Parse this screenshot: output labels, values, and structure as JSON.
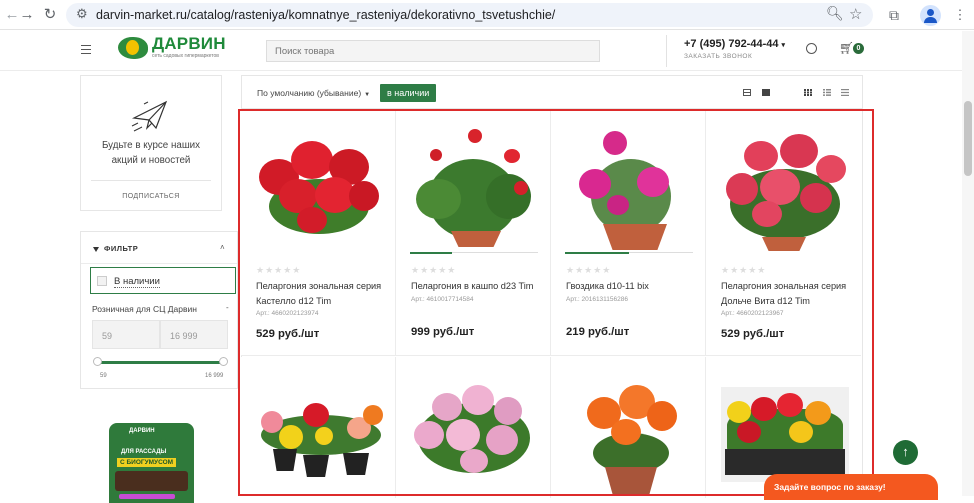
{
  "browser": {
    "url": "darvin-market.ru/catalog/rasteniya/komnatnye_rasteniya/dekorativno_tsvetushchie/"
  },
  "header": {
    "logo_name": "ДАРВИН",
    "logo_sub": "сеть садовых гипермаркетов",
    "search_placeholder": "Поиск товара",
    "phone": "+7 (495) 792-44-44",
    "phone_caret": "▾",
    "callback": "ЗАКАЗАТЬ ЗВОНОК",
    "cart_count": "0"
  },
  "sidebar": {
    "subscribe_text": "Будьте в курсе наших акций и новостей",
    "subscribe_link": "ПОДПИСАТЬСЯ",
    "filter_title": "ФИЛЬТР",
    "in_stock_label": "В наличии",
    "price_title": "Розничная для СЦ Дарвин",
    "price_min_placeholder": "59",
    "price_max_placeholder": "16 999",
    "range_min": "59",
    "range_max": "16 999",
    "banner_brand": "ДАРВИН",
    "banner_line1": "ДЛЯ РАССАДЫ",
    "banner_line2": "С БИОГУМУСОМ"
  },
  "toolbar": {
    "sort_label": "По умолчанию (убывание)",
    "in_stock_button": "в наличии"
  },
  "products": [
    {
      "name": "Пеларгония зональная серия Кастелло d12 Tim",
      "art": "Арт.: 4660202123974",
      "price": "529 руб./шт",
      "stars": "★★★★★"
    },
    {
      "name": "Пеларгония в кашпо d23 Tim",
      "art": "Арт.: 4610017714584",
      "price": "999 руб./шт",
      "stars": "★★★★★",
      "stock_level": 0.33
    },
    {
      "name": "Гвоздика d10-11 bix",
      "art": "Арт.: 2016131156286",
      "price": "219 руб./шт",
      "stars": "★★★★★",
      "stock_level": 0.5
    },
    {
      "name": "Пеларгония зональная серия Дольче Вита d12 Tim",
      "art": "Арт.: 4660202123967",
      "price": "529 руб./шт",
      "stars": "★★★★★"
    }
  ],
  "floating": {
    "ask_label": "Задайте вопрос по заказу!",
    "up_arrow": "↑"
  },
  "icons": [
    "back-icon",
    "forward-icon",
    "reload-icon",
    "tune-icon",
    "zoom-icon",
    "star-icon",
    "extensions-icon",
    "profile-icon",
    "menu-icon",
    "user-icon",
    "cart-icon",
    "paper-plane-icon",
    "funnel-icon",
    "chevron-up-icon",
    "view-table-icon",
    "view-card-icon",
    "grid-icon",
    "list-icon",
    "compact-list-icon",
    "arrow-up-icon"
  ],
  "colors": {
    "brand_green": "#2e7d46",
    "highlight_red": "#dd2b2b",
    "ask_orange": "#f4581f"
  }
}
